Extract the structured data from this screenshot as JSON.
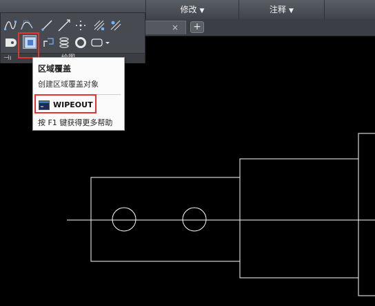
{
  "ribbon": {
    "panels": [
      {
        "label": "修改"
      },
      {
        "label": "注释"
      }
    ],
    "draw_panel_title": "绘图"
  },
  "tabs": {
    "close_glyph": "×",
    "new_glyph": "+"
  },
  "tooltip": {
    "title": "区域覆盖",
    "description": "创建区域覆盖对象",
    "command": "WIPEOUT",
    "help": "按 F1 键获得更多帮助"
  },
  "colors": {
    "highlight": "#e8322c",
    "canvas_background": "#000000",
    "drawing_lines": "#ffffff"
  }
}
